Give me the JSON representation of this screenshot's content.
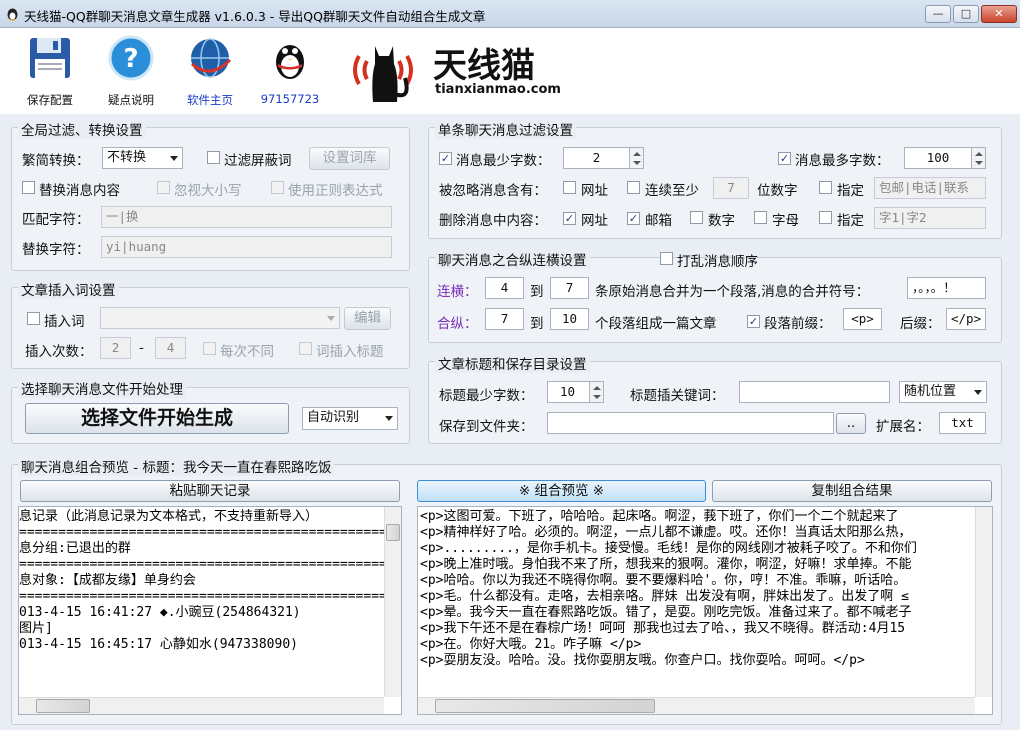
{
  "window": {
    "title": "天线猫-QQ群聊天消息文章生成器 v1.6.0.3 - 导出QQ群聊天文件自动组合生成文章",
    "min": "—",
    "max": "□",
    "close": "✕"
  },
  "toolbar": {
    "save": "保存配置",
    "help": "疑点说明",
    "home": "软件主页",
    "qq": "97157723",
    "brand": "天线猫",
    "brand_url": "tianxianmao.com",
    "home_color": "#1a3cc8"
  },
  "global": {
    "title": "全局过滤、转换设置",
    "convert_label": "繁简转换：",
    "convert_value": "不转换",
    "filter_label": "过滤屏蔽词",
    "setup_lib": "设置词库",
    "replace_content": "替换消息内容",
    "ignore_case": "忽视大小写",
    "use_regex": "使用正则表达式",
    "match_label": "匹配字符：",
    "match_value": "一|换",
    "replace_label": "替换字符：",
    "replace_value": "yi|huang"
  },
  "insert": {
    "title": "文章插入词设置",
    "insert_word": "插入词",
    "edit": "编辑",
    "times_label": "插入次数：",
    "times_from": "2",
    "dash": "-",
    "times_to": "4",
    "each_diff": "每次不同",
    "as_title": "词插入标题"
  },
  "start": {
    "title": "选择聊天消息文件开始处理",
    "button": "选择文件开始生成",
    "mode": "自动识别"
  },
  "single": {
    "title": "单条聊天消息过滤设置",
    "min_len_label": "消息最少字数：",
    "min_len": "2",
    "max_len_label": "消息最多字数：",
    "max_len": "100",
    "ignore_label": "被忽略消息含有：",
    "url": "网址",
    "continuous": "连续至少",
    "digits": "7",
    "digit_unit": "位数字",
    "specify": "指定",
    "ignore_specify": "包邮|电话|联系",
    "delete_label": "删除消息中内容：",
    "email": "邮箱",
    "number": "数字",
    "letter": "字母",
    "delete_specify": "字1|字2"
  },
  "merge": {
    "title": "聊天消息之合纵连横设置",
    "shuffle": "打乱消息顺序",
    "h_label": "连横：",
    "h_from": "4",
    "to1": "到",
    "h_to": "7",
    "h_desc": "条原始消息合并为一个段落,消息的合并符号：",
    "h_symbol": "，。，。！",
    "v_label": "合纵：",
    "v_from": "7",
    "to2": "到",
    "v_to": "10",
    "v_desc": "个段落组成一篇文章",
    "prefix_label": "段落前缀：",
    "prefix": "<p>",
    "suffix_label": "后缀：",
    "suffix": "</p>"
  },
  "titlecfg": {
    "title": "文章标题和保存目录设置",
    "min_label": "标题最少字数：",
    "min": "10",
    "kw_label": "标题插关键词：",
    "kw": "",
    "pos": "随机位置",
    "folder_label": "保存到文件夹：",
    "folder": "",
    "browse": "..",
    "ext_label": "扩展名：",
    "ext": "txt"
  },
  "preview": {
    "title": "聊天消息组合预览 - 标题：我今天一直在春熙路吃饭",
    "paste": "粘贴聊天记录",
    "combine": "※ 组合预览 ※",
    "copy": "复制组合结果",
    "left_lines": [
      "息记录（此消息记录为文本格式，不支持重新导入）",
      "",
      "=========================================================",
      "息分组:已退出的群",
      "=========================================================",
      "息对象:【成都友缘】单身约会",
      "=========================================================",
      "",
      "013-4-15 16:41:27 ◆.小豌豆(254864321)",
      "图片]",
      "",
      "013-4-15 16:45:17 心静如水(947338090)"
    ],
    "right_lines": [
      "<p>这图可爱。下班了，哈哈哈。起床咯。啊涩，莪下班了，你们一个二个就起来了",
      "<p>精神样好了哈。必须的。啊涩，一点儿都不谦虚。哎。还你！当真话太阳那么热，",
      "<p>.........，是你手机卡。接受慢。毛线！是你的网线刚才被耗子咬了。不和你们",
      "<p>晚上准时哦。身怕我不来了所，想我来的狠啊。灌你，啊涩，好嘛！求单捧。不能",
      "<p>哈哈。你以为我还不晓得你啊。要不要爆料哈'。你，哼！不准。乖嘛，听话哈。",
      "<p>毛。什么都没有。走咯，去相亲咯。胖妹 出发没有啊，胖妹出发了。出发了啊 ≤",
      "<p>晕。我今天一直在春熙路吃饭。错了，是耍。刚吃完饭。准备过来了。都不喊老子",
      "<p>我下午还不是在春棕广场！呵呵 那我也过去了哈、，我又不晓得。群活动:4月15",
      "<p>在。你好大哦。21。咋子嘛 </p>",
      "<p>耍朋友没。哈哈。没。找你耍朋友哦。你查户口。找你耍哈。呵呵。</p>"
    ]
  }
}
